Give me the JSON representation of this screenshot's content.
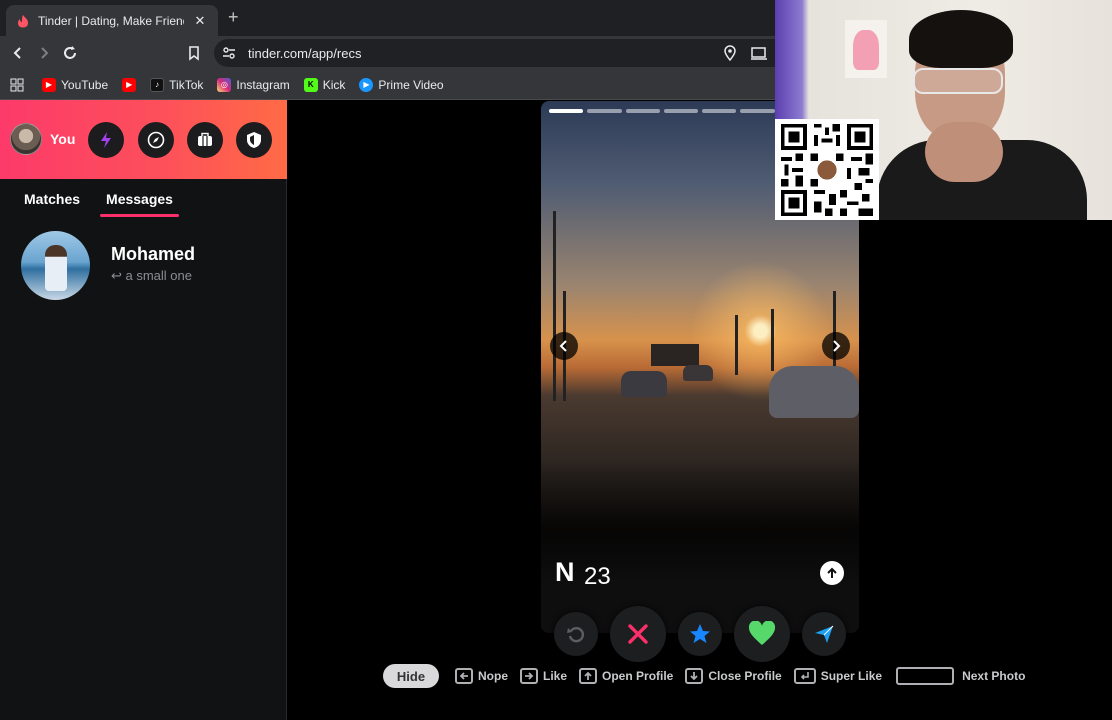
{
  "browser": {
    "tab_title": "Tinder | Dating, Make Friends & Meet New People",
    "url": "tinder.com/app/recs",
    "bookmarks": [
      {
        "label": "YouTube",
        "color": "#ff0000"
      },
      {
        "label": "",
        "color": "#ff0000"
      },
      {
        "label": "TikTok",
        "color": "#111111"
      },
      {
        "label": "Instagram",
        "color": "#d6249f"
      },
      {
        "label": "Kick",
        "color": "#53fc18"
      },
      {
        "label": "Prime Video",
        "color": "#1a98ff"
      }
    ]
  },
  "sidebar": {
    "profile_label": "You",
    "tabs": [
      {
        "label": "Matches"
      },
      {
        "label": "Messages"
      }
    ],
    "active_tab": "Messages",
    "messages": [
      {
        "name": "Mohamed",
        "preview": "↩ a small one"
      }
    ]
  },
  "card": {
    "name": "N",
    "age": "23"
  },
  "shortcuts": {
    "hide": "Hide",
    "nope": "Nope",
    "like": "Like",
    "open_profile": "Open Profile",
    "close_profile": "Close Profile",
    "super_like": "Super Like",
    "next_photo": "Next Photo"
  },
  "colors": {
    "brand_gradient_start": "#fd3a6a",
    "brand_gradient_end": "#ff6b45",
    "nope": "#fd2f6a",
    "super_like": "#1786ff",
    "like": "#56d86a",
    "boost": "#a53ff3"
  }
}
